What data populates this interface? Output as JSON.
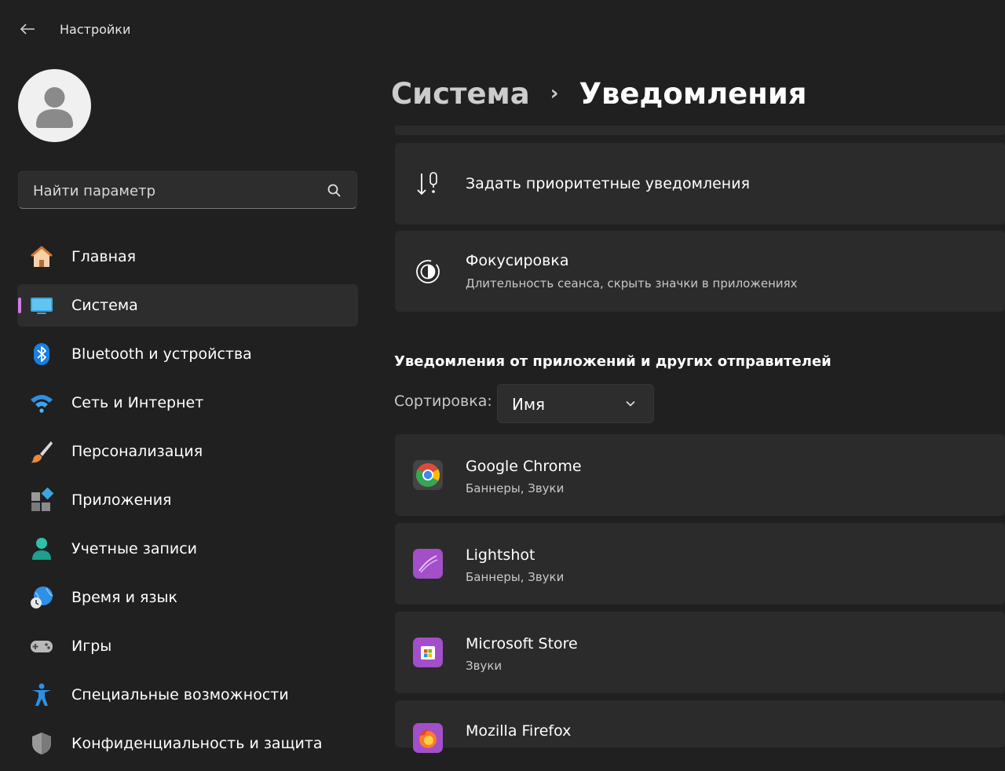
{
  "window": {
    "title": "Настройки"
  },
  "search": {
    "placeholder": "Найти параметр"
  },
  "sidebar": {
    "items": [
      {
        "label": "Главная",
        "icon": "home-icon"
      },
      {
        "label": "Система",
        "icon": "system-icon",
        "active": true
      },
      {
        "label": "Bluetooth и устройства",
        "icon": "bluetooth-icon"
      },
      {
        "label": "Сеть и Интернет",
        "icon": "wifi-icon"
      },
      {
        "label": "Персонализация",
        "icon": "brush-icon"
      },
      {
        "label": "Приложения",
        "icon": "apps-icon"
      },
      {
        "label": "Учетные записи",
        "icon": "account-icon"
      },
      {
        "label": "Время и язык",
        "icon": "time-language-icon"
      },
      {
        "label": "Игры",
        "icon": "gamepad-icon"
      },
      {
        "label": "Специальные возможности",
        "icon": "accessibility-icon"
      },
      {
        "label": "Конфиденциальность и защита",
        "icon": "shield-icon"
      }
    ]
  },
  "breadcrumb": {
    "parent": "Система",
    "separator": "›",
    "current": "Уведомления"
  },
  "cards": {
    "priority": {
      "title": "Задать приоритетные уведомления"
    },
    "focus": {
      "title": "Фокусировка",
      "subtitle": "Длительность сеанса, скрыть значки в приложениях"
    }
  },
  "section": {
    "title": "Уведомления от приложений и других отправителей"
  },
  "sort": {
    "label": "Сортировка:",
    "value": "Имя"
  },
  "apps": [
    {
      "name": "Google Chrome",
      "detail": "Баннеры, Звуки"
    },
    {
      "name": "Lightshot",
      "detail": "Баннеры, Звуки"
    },
    {
      "name": "Microsoft Store",
      "detail": "Звуки"
    },
    {
      "name": "Mozilla Firefox",
      "detail": ""
    }
  ],
  "colors": {
    "background": "#202020",
    "card": "#2b2b2b",
    "accent": "#d17ae8"
  }
}
